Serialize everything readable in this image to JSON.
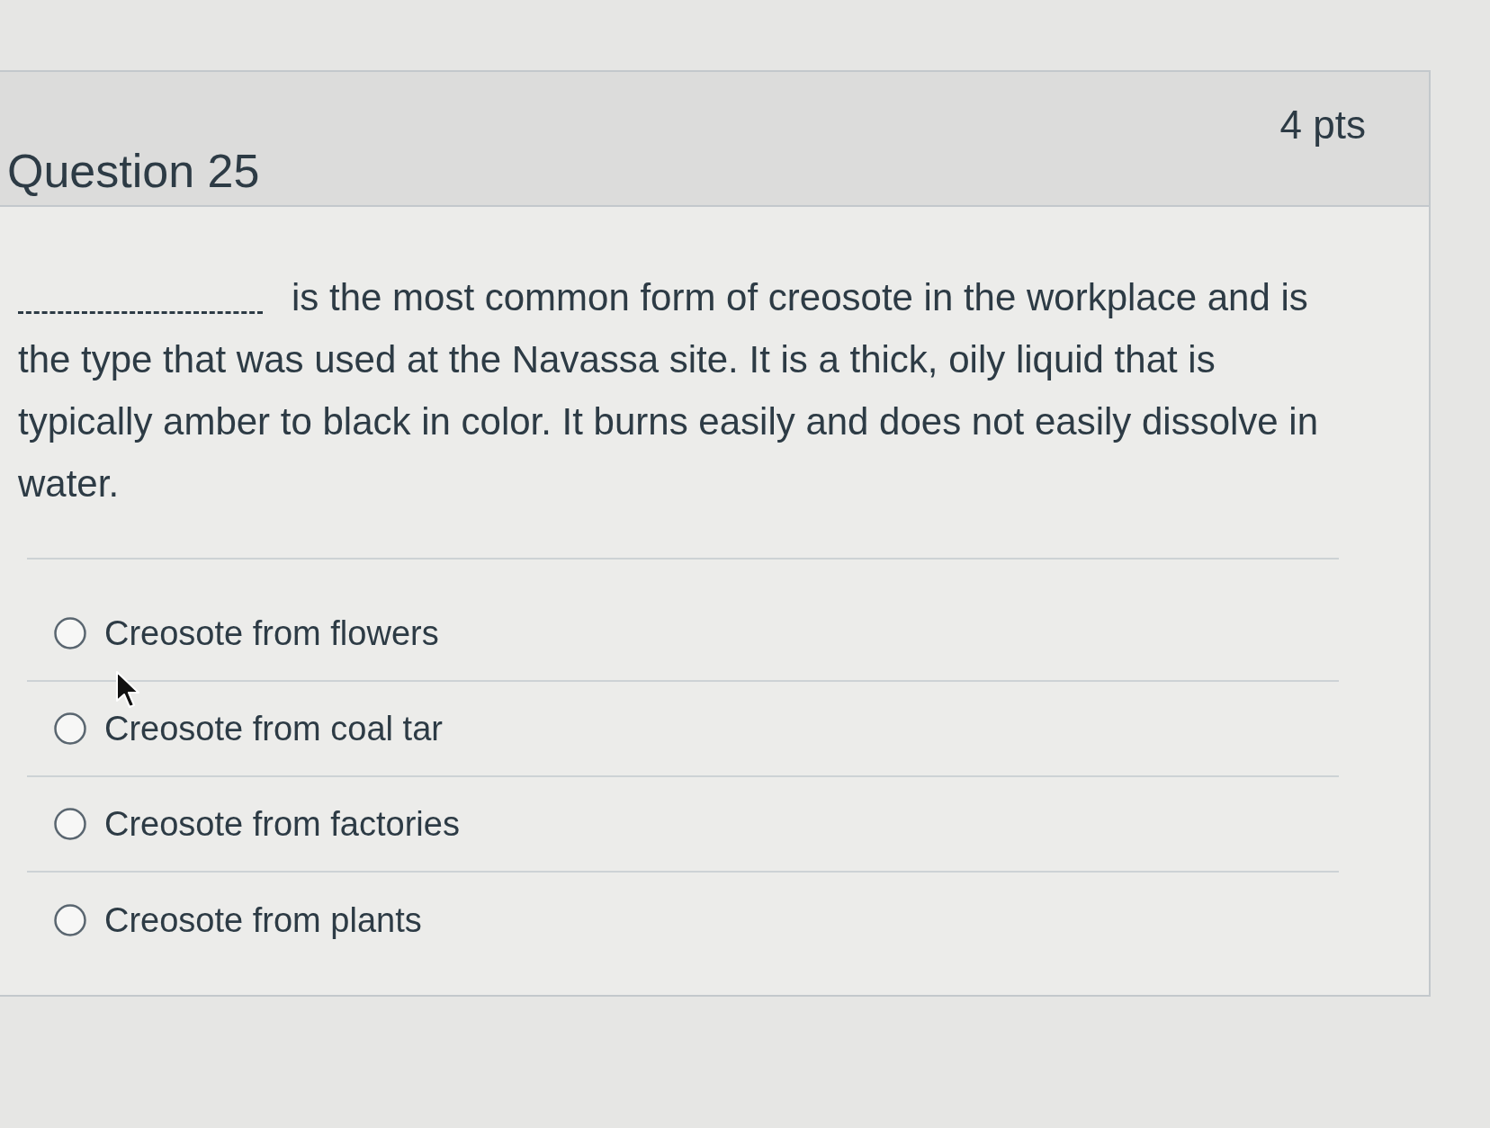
{
  "question": {
    "title": "Question 25",
    "points": "4 pts",
    "text_first_line": "is the most common form of creosote in the workplace and is",
    "text_rest": "the type that was used at the Navassa site. It is a thick, oily liquid that is typically amber to black in color. It burns easily and does not easily dissolve in water."
  },
  "answers": [
    {
      "label": "Creosote from flowers",
      "selected": false
    },
    {
      "label": "Creosote from coal tar",
      "selected": false
    },
    {
      "label": "Creosote from factories",
      "selected": false
    },
    {
      "label": "Creosote from plants",
      "selected": false
    }
  ]
}
